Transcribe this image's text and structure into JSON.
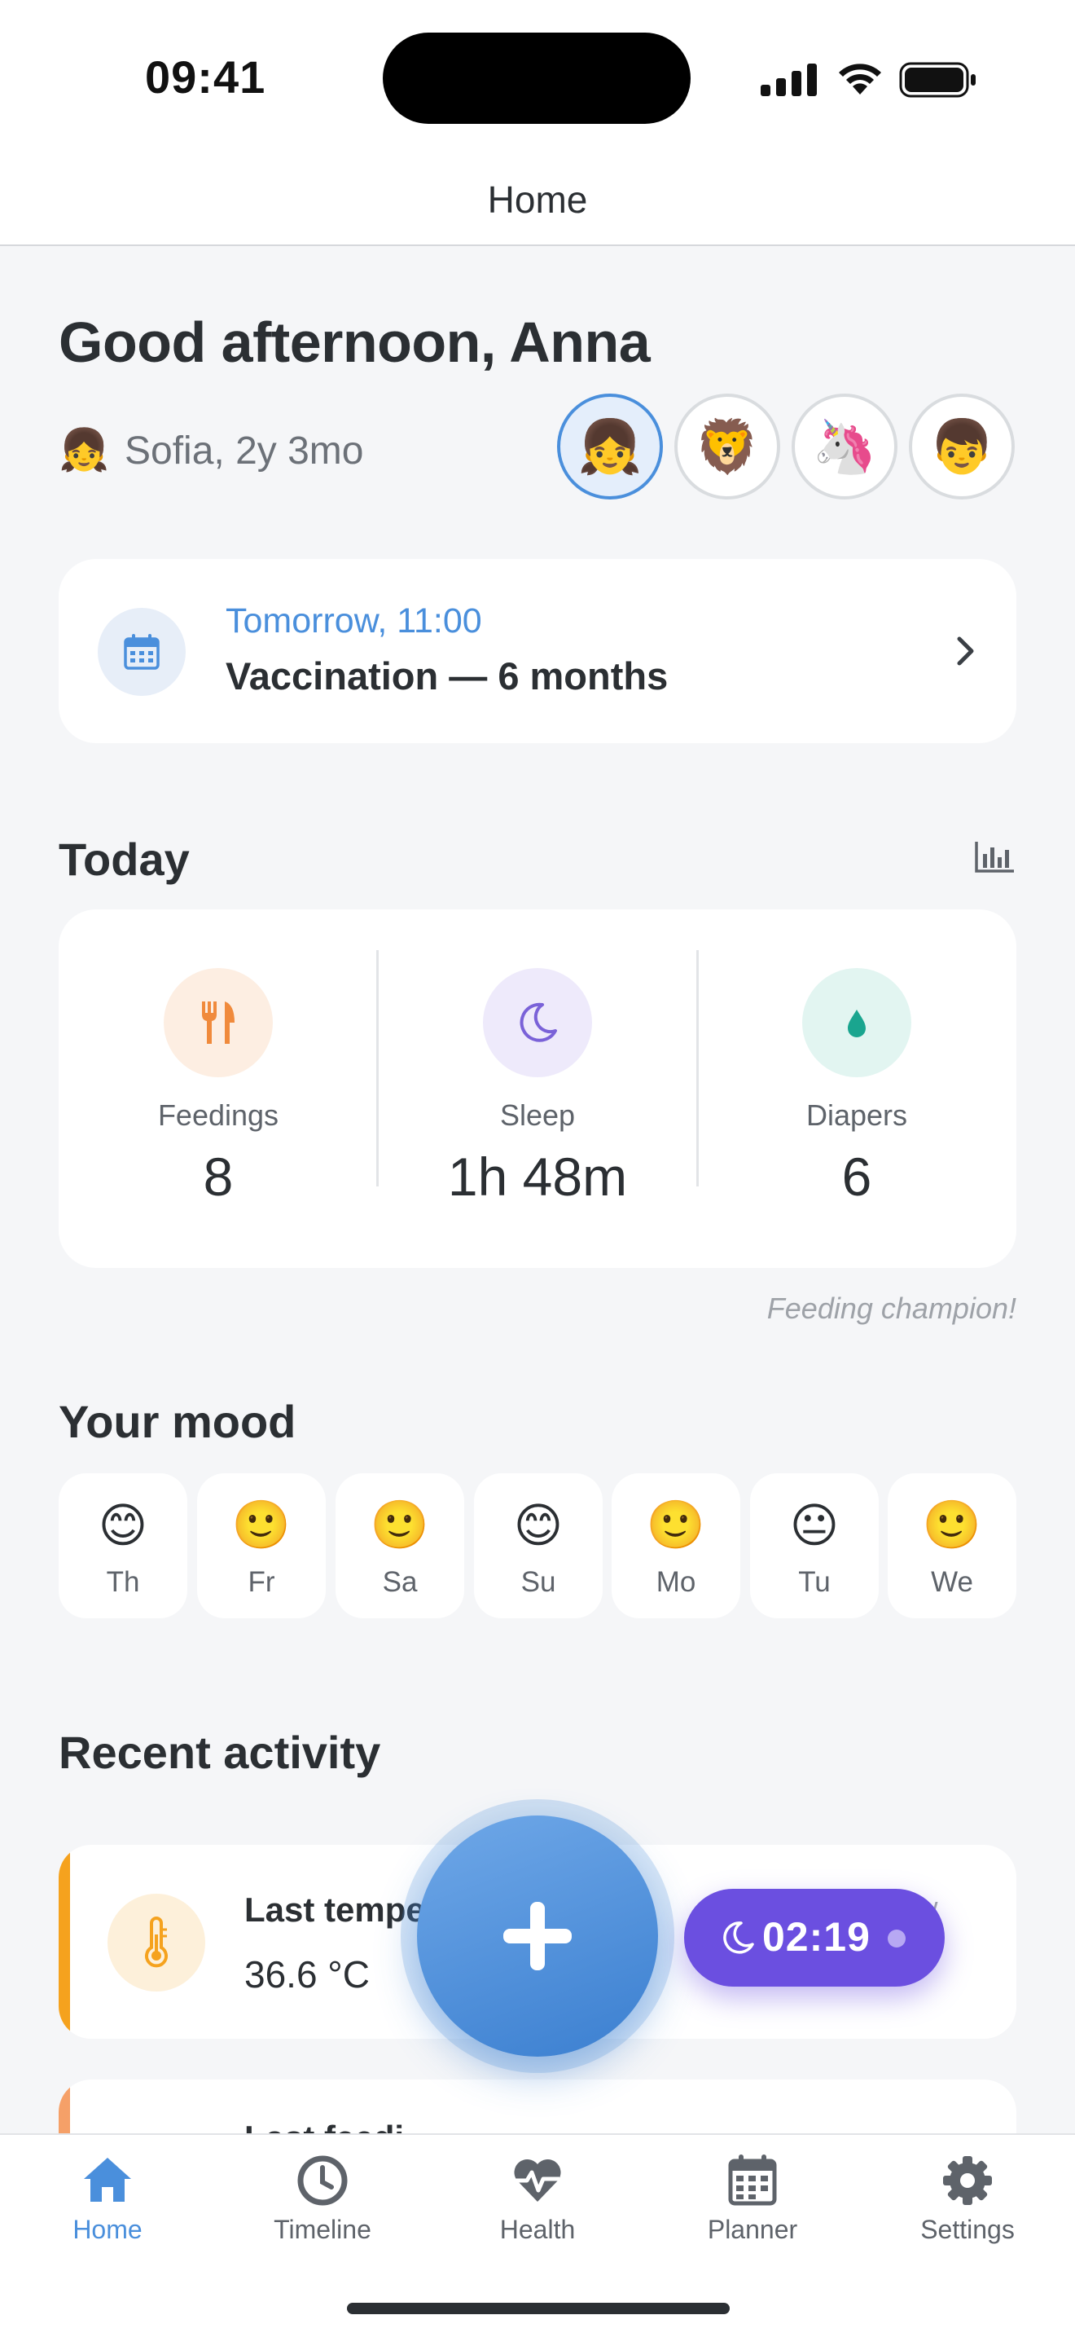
{
  "status_bar": {
    "time": "09:41"
  },
  "nav": {
    "title": "Home"
  },
  "greeting": "Good afternoon, Anna",
  "child": {
    "emoji": "👧",
    "label": "Sofia, 2y 3mo"
  },
  "avatars": [
    {
      "emoji": "👧",
      "selected": true
    },
    {
      "emoji": "🦁",
      "selected": false
    },
    {
      "emoji": "🦄",
      "selected": false
    },
    {
      "emoji": "👦",
      "selected": false
    }
  ],
  "appointment": {
    "time": "Tomorrow, 11:00",
    "title": "Vaccination — 6 months",
    "icon": "calendar-icon"
  },
  "today": {
    "title": "Today",
    "stats": [
      {
        "label": "Feedings",
        "value": "8",
        "icon": "fork-knife-icon",
        "color": "#f08a3c",
        "bg": "#fdeee2"
      },
      {
        "label": "Sleep",
        "value": "1h 48m",
        "icon": "moon-icon",
        "color": "#7a62d8",
        "bg": "#eeeafb"
      },
      {
        "label": "Diapers",
        "value": "6",
        "icon": "drop-icon",
        "color": "#1aa58f",
        "bg": "#e2f5f1"
      }
    ],
    "note": "Feeding champion!"
  },
  "mood": {
    "title": "Your mood",
    "days": [
      {
        "emoji": "😊",
        "day": "Th"
      },
      {
        "emoji": "🙂",
        "day": "Fr"
      },
      {
        "emoji": "🙂",
        "day": "Sa"
      },
      {
        "emoji": "😊",
        "day": "Su"
      },
      {
        "emoji": "🙂",
        "day": "Mo"
      },
      {
        "emoji": "😐",
        "day": "Tu"
      },
      {
        "emoji": "🙂",
        "day": "We"
      }
    ]
  },
  "recent": {
    "title": "Recent activity",
    "items": [
      {
        "title": "Last tempe",
        "value": "36.6 °C",
        "when": "ow",
        "icon": "thermometer-icon",
        "accent": "#f5a21e"
      },
      {
        "title": "Last feedi",
        "accent": "#f5a068"
      }
    ]
  },
  "sleep_timer": {
    "time": "02:19",
    "icon": "moon-icon"
  },
  "tabs": [
    {
      "label": "Home",
      "icon": "home-icon",
      "active": true
    },
    {
      "label": "Timeline",
      "icon": "clock-icon",
      "active": false
    },
    {
      "label": "Health",
      "icon": "heart-pulse-icon",
      "active": false
    },
    {
      "label": "Planner",
      "icon": "calendar-icon",
      "active": false
    },
    {
      "label": "Settings",
      "icon": "gear-icon",
      "active": false
    }
  ],
  "colors": {
    "accent": "#4a8fdc",
    "timer": "#6b4fe0",
    "background": "#f5f6f8"
  }
}
